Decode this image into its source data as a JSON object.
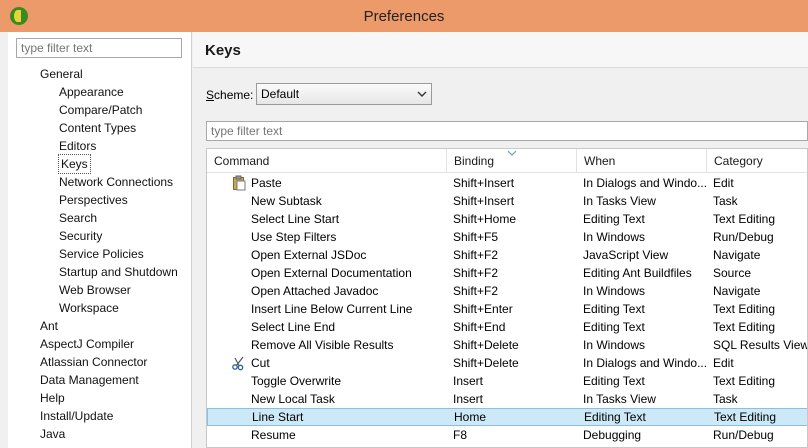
{
  "window": {
    "title": "Preferences"
  },
  "left": {
    "filter_placeholder": "type filter text",
    "tree": [
      {
        "label": "General",
        "level": 0
      },
      {
        "label": "Appearance",
        "level": 1
      },
      {
        "label": "Compare/Patch",
        "level": 1
      },
      {
        "label": "Content Types",
        "level": 1
      },
      {
        "label": "Editors",
        "level": 1
      },
      {
        "label": "Keys",
        "level": 1,
        "selected": true
      },
      {
        "label": "Network Connections",
        "level": 1
      },
      {
        "label": "Perspectives",
        "level": 1
      },
      {
        "label": "Search",
        "level": 1
      },
      {
        "label": "Security",
        "level": 1
      },
      {
        "label": "Service Policies",
        "level": 1
      },
      {
        "label": "Startup and Shutdown",
        "level": 1
      },
      {
        "label": "Web Browser",
        "level": 1
      },
      {
        "label": "Workspace",
        "level": 1
      },
      {
        "label": "Ant",
        "level": 0
      },
      {
        "label": "AspectJ Compiler",
        "level": 0
      },
      {
        "label": "Atlassian Connector",
        "level": 0
      },
      {
        "label": "Data Management",
        "level": 0
      },
      {
        "label": "Help",
        "level": 0
      },
      {
        "label": "Install/Update",
        "level": 0
      },
      {
        "label": "Java",
        "level": 0
      }
    ]
  },
  "page": {
    "title": "Keys",
    "scheme_label_prefix": "S",
    "scheme_label_rest": "cheme:",
    "scheme_value": "Default",
    "filter_placeholder": "type filter text"
  },
  "table": {
    "columns": [
      "Command",
      "Binding",
      "When",
      "Category"
    ],
    "rows": [
      {
        "icon": "paste-icon",
        "command": "Paste",
        "binding": "Shift+Insert",
        "when": "In Dialogs and Windo...",
        "category": "Edit"
      },
      {
        "command": "New Subtask",
        "binding": "Shift+Insert",
        "when": "In Tasks View",
        "category": "Task"
      },
      {
        "command": "Select Line Start",
        "binding": "Shift+Home",
        "when": "Editing Text",
        "category": "Text Editing"
      },
      {
        "command": "Use Step Filters",
        "binding": "Shift+F5",
        "when": "In Windows",
        "category": "Run/Debug"
      },
      {
        "command": "Open External JSDoc",
        "binding": "Shift+F2",
        "when": "JavaScript View",
        "category": "Navigate"
      },
      {
        "command": "Open External Documentation",
        "binding": "Shift+F2",
        "when": "Editing Ant Buildfiles",
        "category": "Source"
      },
      {
        "command": "Open Attached Javadoc",
        "binding": "Shift+F2",
        "when": "In Windows",
        "category": "Navigate"
      },
      {
        "command": "Insert Line Below Current Line",
        "binding": "Shift+Enter",
        "when": "Editing Text",
        "category": "Text Editing"
      },
      {
        "command": "Select Line End",
        "binding": "Shift+End",
        "when": "Editing Text",
        "category": "Text Editing"
      },
      {
        "command": "Remove All Visible Results",
        "binding": "Shift+Delete",
        "when": "In Windows",
        "category": "SQL Results View"
      },
      {
        "icon": "cut-icon",
        "command": "Cut",
        "binding": "Shift+Delete",
        "when": "In Dialogs and Windo...",
        "category": "Edit"
      },
      {
        "command": "Toggle Overwrite",
        "binding": "Insert",
        "when": "Editing Text",
        "category": "Text Editing"
      },
      {
        "command": "New Local Task",
        "binding": "Insert",
        "when": "In Tasks View",
        "category": "Task"
      },
      {
        "command": "Line Start",
        "binding": "Home",
        "when": "Editing Text",
        "category": "Text Editing",
        "selected": true
      },
      {
        "command": "Resume",
        "binding": "F8",
        "when": "Debugging",
        "category": "Run/Debug"
      }
    ]
  }
}
